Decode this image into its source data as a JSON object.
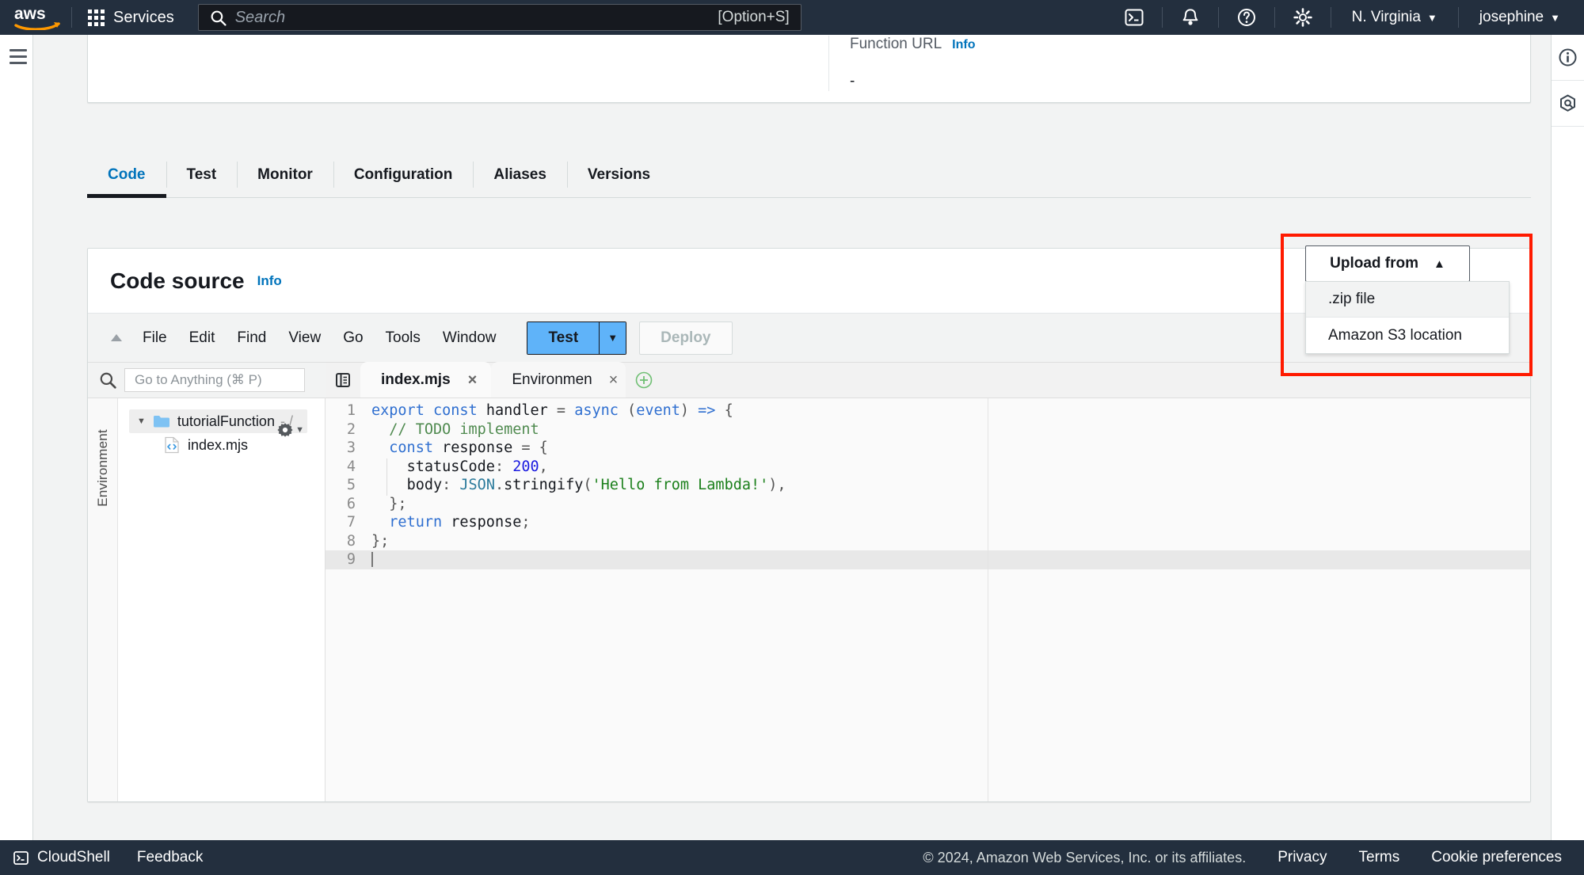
{
  "topnav": {
    "logo_alt": "aws",
    "services_label": "Services",
    "search": {
      "placeholder": "Search",
      "shortcut": "[Option+S]"
    },
    "icons": [
      "cloudshell-icon",
      "bell-icon",
      "help-icon",
      "settings-icon"
    ],
    "region": "N. Virginia",
    "account": "josephine",
    "caret": "▼"
  },
  "rightrail": {
    "items": [
      "info-icon",
      "shortcuts-icon"
    ]
  },
  "infocard": {
    "function_url_label": "Function URL",
    "info_label": "Info",
    "function_url_value": "-"
  },
  "tabs": [
    {
      "label": "Code",
      "active": true
    },
    {
      "label": "Test",
      "active": false
    },
    {
      "label": "Monitor",
      "active": false
    },
    {
      "label": "Configuration",
      "active": false
    },
    {
      "label": "Aliases",
      "active": false
    },
    {
      "label": "Versions",
      "active": false
    }
  ],
  "codesource": {
    "title": "Code source",
    "info_label": "Info",
    "menu": [
      "File",
      "Edit",
      "Find",
      "View",
      "Go",
      "Tools",
      "Window"
    ],
    "collapse_icon": "▲",
    "test_button": "Test",
    "test_caret": "▼",
    "deploy_button": "Deploy"
  },
  "upload": {
    "button_label": "Upload from",
    "button_caret": "▲",
    "options": [
      {
        "label": ".zip file",
        "hover": true
      },
      {
        "label": "Amazon S3 location",
        "hover": false
      }
    ],
    "highlight_color": "#ff1a00"
  },
  "explorer": {
    "search_placeholder": "Go to Anything (⌘ P)",
    "strip_label": "Environment",
    "tree": {
      "folder": {
        "name": "tutorialFunction",
        "suffix": "- /",
        "expanded": true,
        "caret": "▼"
      },
      "files": [
        {
          "name": "index.mjs"
        }
      ]
    }
  },
  "editor": {
    "tabs": [
      {
        "label": "index.mjs",
        "active": true,
        "close": "×"
      },
      {
        "label": "Environment Vari",
        "active": false,
        "close": "×"
      }
    ],
    "add_tab": "+",
    "line_numbers": [
      "1",
      "2",
      "3",
      "4",
      "5",
      "6",
      "7",
      "8",
      "9"
    ],
    "active_line": 9,
    "code_lines": [
      "export const handler = async (event) => {",
      "  // TODO implement",
      "  const response = {",
      "    statusCode: 200,",
      "    body: JSON.stringify('Hello from Lambda!'),",
      "  };",
      "  return response;",
      "};",
      ""
    ]
  },
  "footer": {
    "cloudshell": "CloudShell",
    "feedback": "Feedback",
    "copyright": "© 2024, Amazon Web Services, Inc. or its affiliates.",
    "links": [
      "Privacy",
      "Terms",
      "Cookie preferences"
    ]
  }
}
